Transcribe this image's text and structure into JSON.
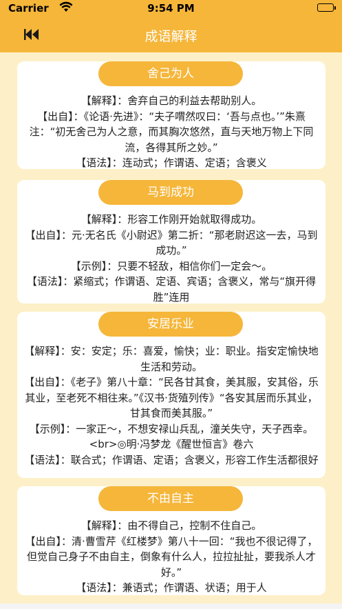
{
  "status_bar": {
    "carrier": "Carrier",
    "time": "9:54 PM"
  },
  "nav": {
    "title": "成语解释",
    "back_icon": "double-left-arrow-icon"
  },
  "cards": [
    {
      "title": "舍己为人",
      "lines": [
        "【解释】：舍弃自己的利益去帮助别人。",
        "【出自】：《论语·先进》：“夫子喟然叹曰：‘吾与点也。’”朱熹注：“初无舍己为人之意，而其胸次悠然，直与天地万物上下同流，各得其所之妙。”",
        "【语法】：连动式；作谓语、定语；含褒义"
      ]
    },
    {
      "title": "马到成功",
      "lines": [
        "【解释】：形容工作刚开始就取得成功。",
        "【出自】：元·无名氏《小尉迟》第二折：“那老尉迟这一去，马到成功。”",
        "【示例】：只要不轻敌，相信你们一定会～。",
        "【语法】：紧缩式；作谓语、定语、宾语；含褒义，常与“旗开得胜”连用"
      ]
    },
    {
      "title": "安居乐业",
      "lines": [
        "【解释】：安：安定；乐：喜爱，愉快；业：职业。指安定愉快地生活和劳动。",
        "【出自】：《老子》第八十章：“民各甘其食，美其服，安其俗，乐其业，至老死不相往来。”《汉书·货殖列传》“各安其居而乐其业，甘其食而美其服。”",
        "【示例】：一家正～，不想安禄山兵乱，潼关失守，天子西幸。<br>◎明·冯梦龙《醒世恒言》卷六",
        "【语法】：联合式；作谓语、定语；含褒义，形容工作生活都很好"
      ]
    },
    {
      "title": "不由自主",
      "lines": [
        "【解释】：由不得自己，控制不住自己。",
        "【出自】：清·曹雪芹《红楼梦》第八十一回：“我也不很记得了，但觉自己身子不由自主，倒象有什么人，拉拉扯扯，要我杀人才好。”",
        "【语法】：兼语式；作谓语、状语；用于人"
      ]
    }
  ]
}
